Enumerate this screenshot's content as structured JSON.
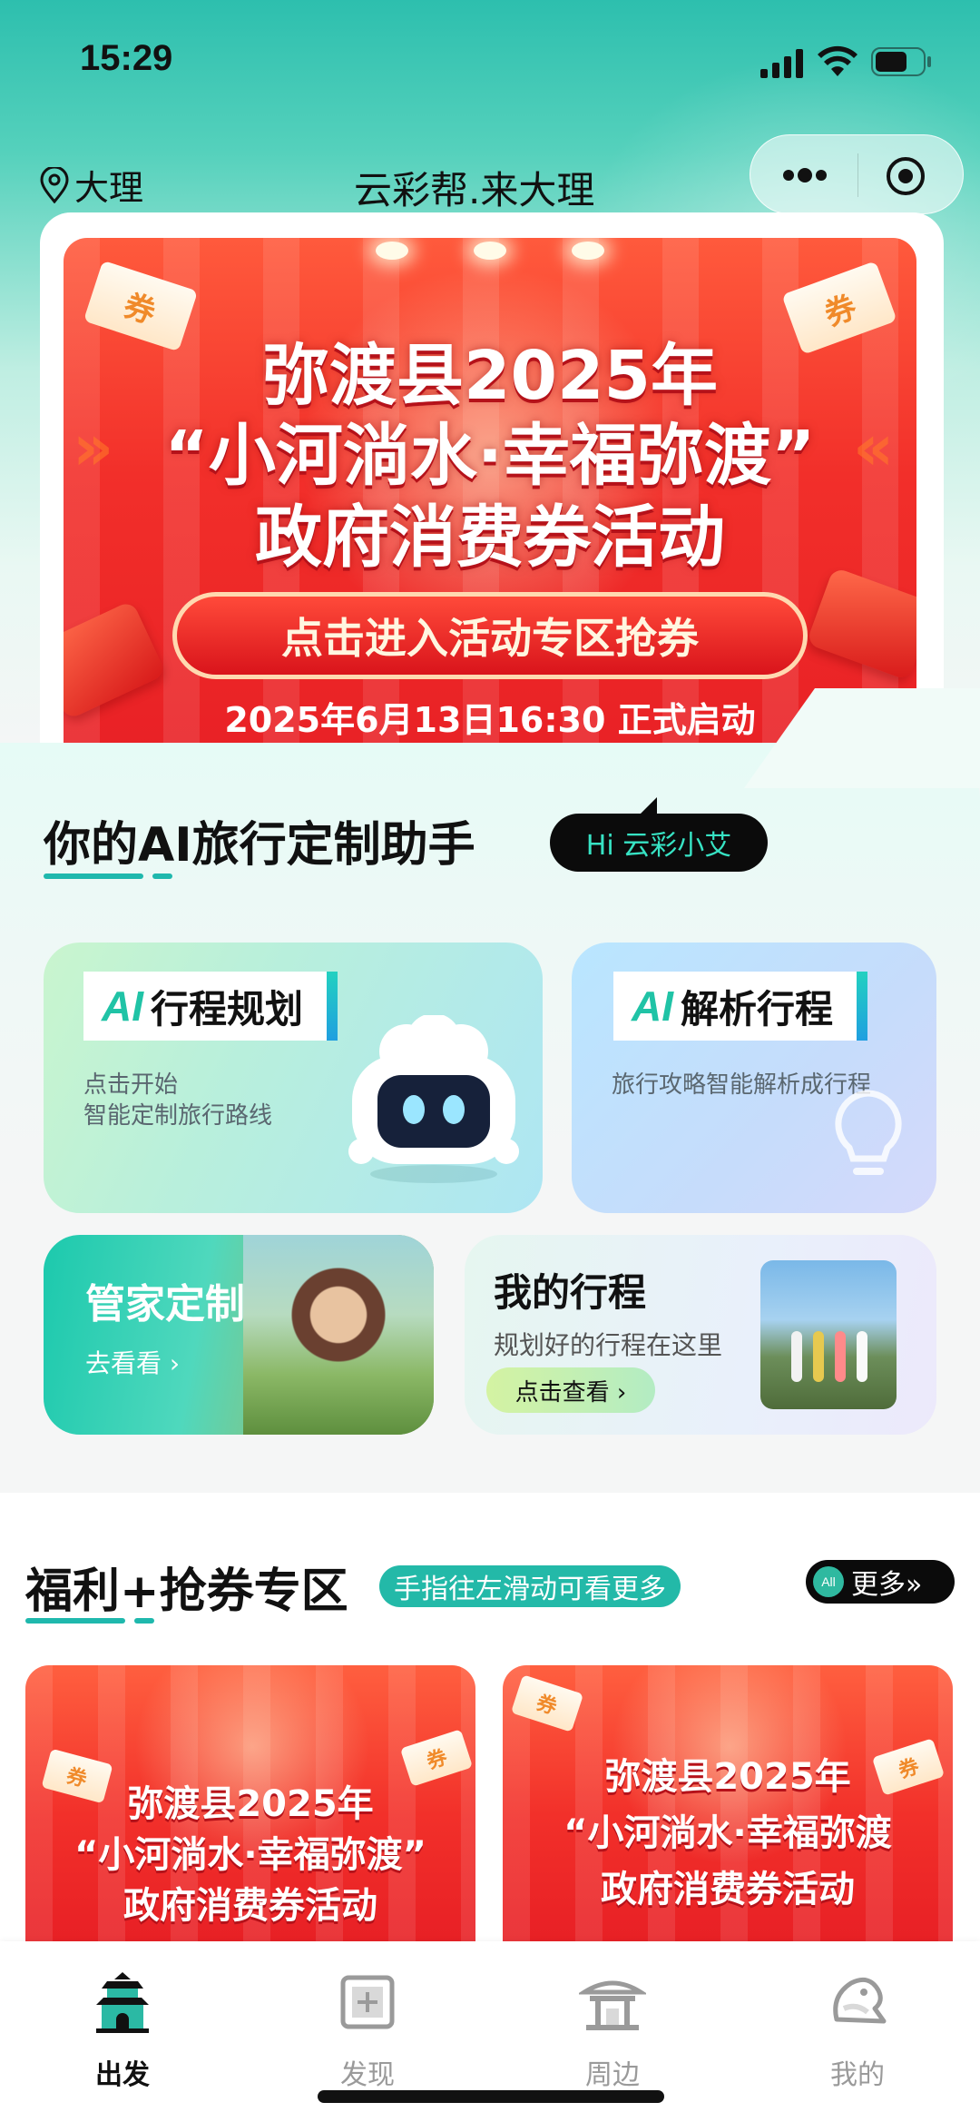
{
  "status_bar": {
    "time": "15:29"
  },
  "header": {
    "location": "大理",
    "title": "云彩帮.来大理"
  },
  "banner": {
    "line1": "弥渡县2025年",
    "line2": "“小河淌水·幸福弥渡”",
    "line3": "政府消费券活动",
    "button": "点击进入活动专区抢券",
    "date": "2025年6月13日16:30 正式启动",
    "ticket": "券"
  },
  "ai_section": {
    "title": "你的AI旅行定制助手",
    "bubble": "Hi 云彩小艾",
    "plan_card": {
      "ai": "AI",
      "label": "行程规划",
      "sub1": "点击开始",
      "sub2": "智能定制旅行路线"
    },
    "parse_card": {
      "ai": "AI",
      "label": "解析行程",
      "sub": "旅行攻略智能解析成行程"
    },
    "butler_card": {
      "title": "管家定制",
      "link": "去看看 ›"
    },
    "trip_card": {
      "title": "我的行程",
      "sub": "规划好的行程在这里",
      "button": "点击查看 ›"
    }
  },
  "benefits": {
    "title": "福利+抢券专区",
    "hint": "手指往左滑动可看更多",
    "more_badge": "All",
    "more": "更多»",
    "promos": [
      {
        "line1": "弥渡县2025年",
        "line2": "“小河淌水·幸福弥渡”",
        "line3": "政府消费券活动",
        "ticket": "券"
      },
      {
        "line1": "弥渡县2025年",
        "line2": "“小河淌水·幸福弥渡",
        "line3": "政府消费券活动",
        "ticket": "券"
      }
    ]
  },
  "tabbar": {
    "items": [
      {
        "label": "出发",
        "icon": "gate-tower-icon",
        "active": true
      },
      {
        "label": "发现",
        "icon": "map-frame-icon",
        "active": false
      },
      {
        "label": "周边",
        "icon": "pavilion-icon",
        "active": false
      },
      {
        "label": "我的",
        "icon": "profile-bird-icon",
        "active": false
      }
    ]
  },
  "colors": {
    "accent": "#1fb8ad",
    "banner_red": "#e61d24",
    "text": "#111111"
  }
}
